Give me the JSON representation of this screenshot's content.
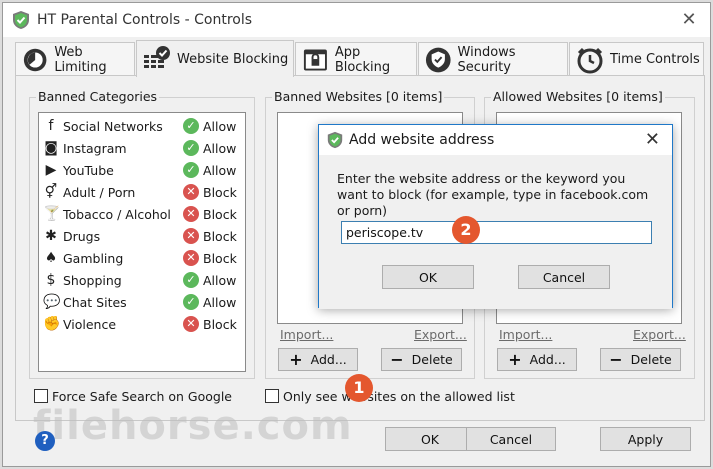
{
  "window": {
    "title": "HT Parental Controls - Controls",
    "close_label": "✕"
  },
  "tabs": [
    {
      "label": "Web Limiting",
      "icon": "web-limiting-icon"
    },
    {
      "label": "Website Blocking",
      "icon": "website-blocking-icon"
    },
    {
      "label": "App Blocking",
      "icon": "app-blocking-icon"
    },
    {
      "label": "Windows Security",
      "icon": "windows-security-icon"
    },
    {
      "label": "Time Controls",
      "icon": "time-controls-icon"
    }
  ],
  "banned_categories": {
    "label": "Banned Categories",
    "items": [
      {
        "name": "Social Networks",
        "status": "Allow",
        "icon": "f"
      },
      {
        "name": "Instagram",
        "status": "Allow",
        "icon": "◙"
      },
      {
        "name": "YouTube",
        "status": "Allow",
        "icon": "▶"
      },
      {
        "name": "Adult / Porn",
        "status": "Block",
        "icon": "⚥"
      },
      {
        "name": "Tobacco / Alcohol",
        "status": "Block",
        "icon": "🍸"
      },
      {
        "name": "Drugs",
        "status": "Block",
        "icon": "✱"
      },
      {
        "name": "Gambling",
        "status": "Block",
        "icon": "♠"
      },
      {
        "name": "Shopping",
        "status": "Allow",
        "icon": "$"
      },
      {
        "name": "Chat Sites",
        "status": "Allow",
        "icon": "💬"
      },
      {
        "name": "Violence",
        "status": "Block",
        "icon": "✊"
      }
    ]
  },
  "banned_websites": {
    "label": "Banned Websites [0 items]",
    "import": "Import...",
    "export": "Export...",
    "add": "Add...",
    "delete": "Delete"
  },
  "allowed_websites": {
    "label": "Allowed Websites [0 items]",
    "import": "Import...",
    "export": "Export...",
    "add": "Add...",
    "delete": "Delete"
  },
  "options": {
    "safe_search": "Force Safe Search on Google",
    "only_allowed": "Only see websites on the allowed list"
  },
  "footer": {
    "ok": "OK",
    "cancel": "Cancel",
    "apply": "Apply",
    "help": "?"
  },
  "watermark": "filehorse.com",
  "dialog": {
    "title": "Add website address",
    "description": "Enter the website address or the keyword you want to block (for example, type in facebook.com or porn)",
    "input_value": "periscope.tv",
    "ok": "OK",
    "cancel": "Cancel"
  },
  "markers": [
    "1",
    "2"
  ],
  "colors": {
    "allow": "#5cb85c",
    "block": "#d9534f",
    "marker": "#e4572e",
    "accent": "#1f78c8"
  }
}
